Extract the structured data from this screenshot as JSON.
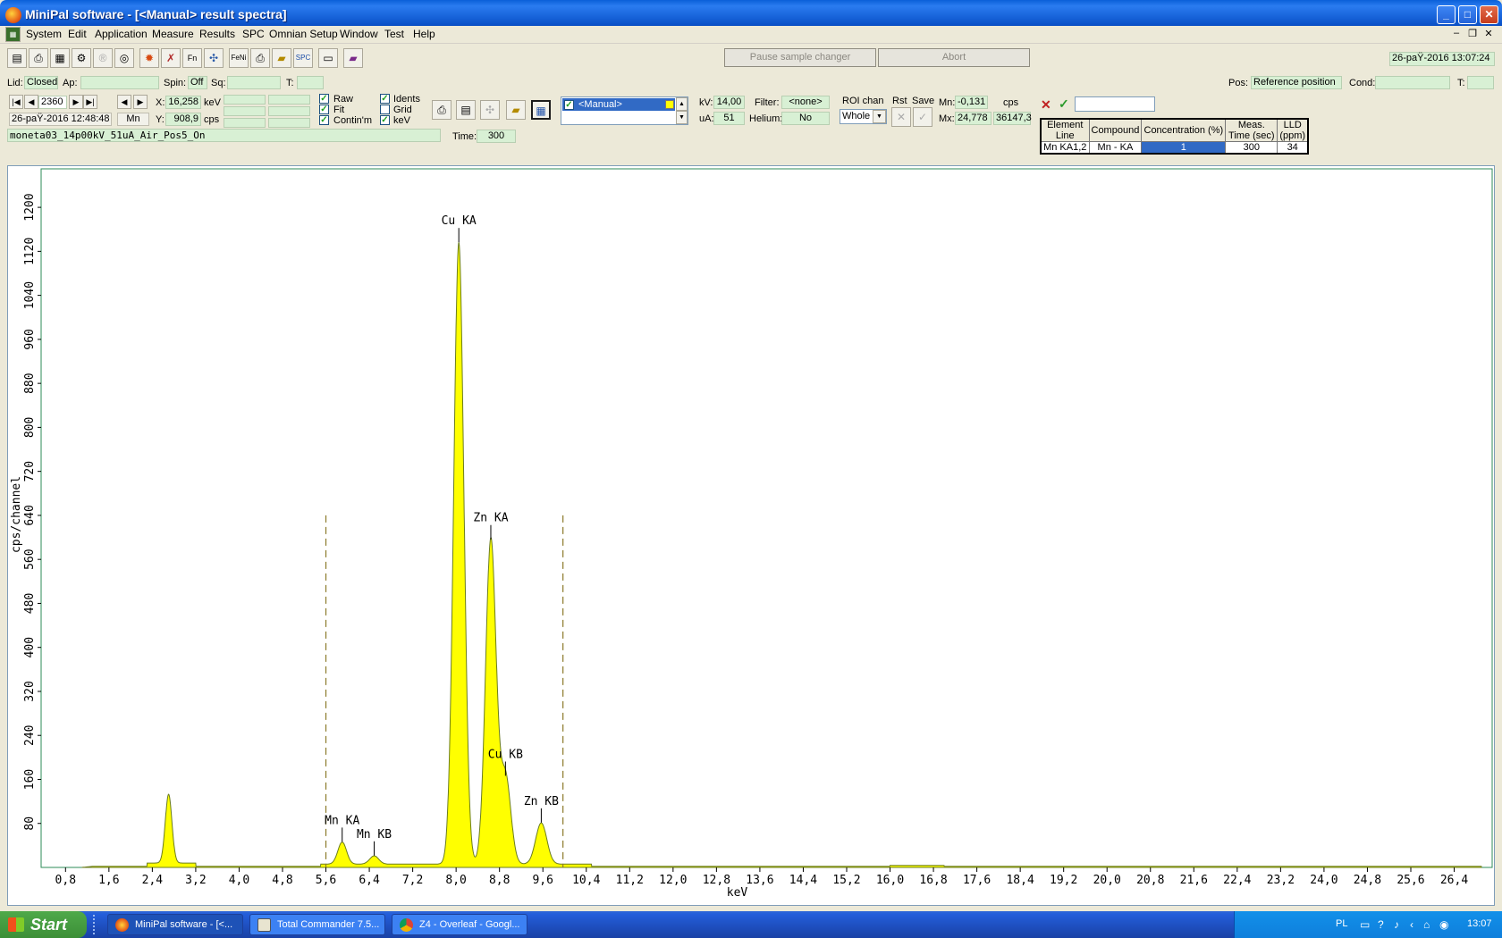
{
  "window": {
    "title": "MiniPal software - [<Manual> result spectra]"
  },
  "menu": [
    "System",
    "Edit",
    "Application",
    "Measure",
    "Results",
    "SPC",
    "Omnian Setup",
    "Window",
    "Test",
    "Help"
  ],
  "toolbar": {
    "pause_label": "Pause sample changer",
    "abort_label": "Abort",
    "datetime": "26-paŸ-2016 13:07:24"
  },
  "status": {
    "lid_label": "Lid:",
    "lid": "Closed",
    "ap_label": "Ap:",
    "ap": "",
    "spin_label": "Spin:",
    "spin": "Off",
    "sq_label": "Sq:",
    "sq": "",
    "t_label": "T:",
    "t": "",
    "pos_label": "Pos:",
    "pos": "Reference position",
    "cond_label": "Cond:",
    "cond": "",
    "t2_label": "T:",
    "t2": ""
  },
  "spectrum": {
    "channel": "2360",
    "date": "26-paŸ-2016 12:48:48",
    "element": "Mn",
    "x_label": "X:",
    "x": "16,258",
    "x_unit": "keV",
    "y_label": "Y:",
    "y": "908,9",
    "y_unit": "cps",
    "file": "moneta03_14p00kV_51uA_Air_Pos5_On",
    "time_label": "Time:",
    "time": "300"
  },
  "checkboxes": {
    "raw": "Raw",
    "fit": "Fit",
    "contin": "Contin'm",
    "idents": "Idents",
    "grid": "Grid",
    "kev": "keV"
  },
  "condition": {
    "name": "<Manual>",
    "kv_label": "kV:",
    "kv": "14,00",
    "ua_label": "uA:",
    "ua": "51",
    "filter_label": "Filter:",
    "filter": "<none>",
    "helium_label": "Helium:",
    "helium": "No"
  },
  "roi": {
    "chan_label": "ROI chan",
    "chan": "Whole",
    "rst_label": "Rst",
    "save_label": "Save",
    "mn_label": "Mn:",
    "mn": "-0,131",
    "mx_label": "Mx:",
    "mx": "24,778",
    "cps_label": "cps",
    "cps": "36147,3"
  },
  "results": {
    "headers": [
      "Element Line",
      "Compound",
      "Concentration (%)",
      "Meas. Time (sec)",
      "LLD (ppm)"
    ],
    "row": [
      "Mn  KA1,2",
      "Mn - KA",
      "1",
      "300",
      "34"
    ]
  },
  "chart_data": {
    "type": "line",
    "xlabel": "keV",
    "ylabel": "cps/channel",
    "xlim": [
      0.35,
      27.1
    ],
    "ylim": [
      0,
      1270
    ],
    "xticks": [
      "0,8",
      "1,6",
      "2,4",
      "3,2",
      "4,0",
      "4,8",
      "5,6",
      "6,4",
      "7,2",
      "8,0",
      "8,8",
      "9,6",
      "10,4",
      "11,2",
      "12,0",
      "12,8",
      "13,6",
      "14,4",
      "15,2",
      "16,0",
      "16,8",
      "17,6",
      "18,4",
      "19,2",
      "20,0",
      "20,8",
      "21,6",
      "22,4",
      "23,2",
      "24,0",
      "24,8",
      "25,6",
      "26,4"
    ],
    "yticks": [
      "80",
      "160",
      "240",
      "320",
      "400",
      "480",
      "560",
      "640",
      "720",
      "800",
      "880",
      "960",
      "1040",
      "1120",
      "1200"
    ],
    "roi_markers": [
      5.6,
      9.97
    ],
    "roi_height": 640,
    "peaks": [
      {
        "label": "Cu KA",
        "x": 8.05,
        "y": 1130
      },
      {
        "label": "Zn KA",
        "x": 8.64,
        "y": 590
      },
      {
        "label": "Cu KB",
        "x": 8.91,
        "y": 160
      },
      {
        "label": "Zn KB",
        "x": 9.57,
        "y": 75
      },
      {
        "label": "Mn KA",
        "x": 5.9,
        "y": 40
      },
      {
        "label": "Mn KB",
        "x": 6.49,
        "y": 15
      }
    ],
    "unlabeled_peaks": [
      {
        "x": 2.7,
        "y": 125
      }
    ],
    "series_fill_color": "#ffff00",
    "series_line_color": "#6b7d1e"
  },
  "taskbar": {
    "start": "Start",
    "tasks": [
      "MiniPal software - [<...",
      "Total Commander 7.5...",
      "Z4 - Overleaf - Googl..."
    ],
    "lang": "PL",
    "clock": "13:07"
  }
}
